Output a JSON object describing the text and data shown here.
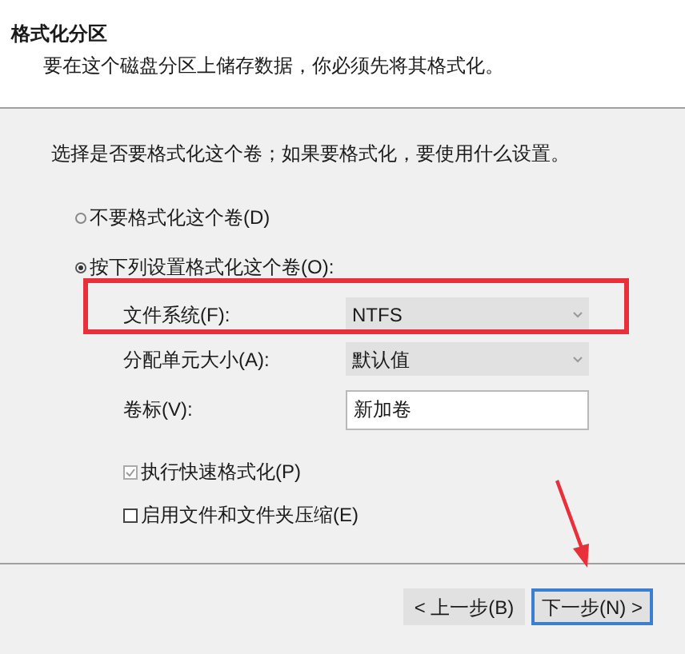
{
  "header": {
    "title": "格式化分区",
    "subtitle": "要在这个磁盘分区上储存数据，你必须先将其格式化。"
  },
  "instruction": "选择是否要格式化这个卷；如果要格式化，要使用什么设置。",
  "options": [
    {
      "label": "不要格式化这个卷(D)",
      "selected": false
    },
    {
      "label": "按下列设置格式化这个卷(O):",
      "selected": true
    }
  ],
  "settings": [
    {
      "kind": "dropdown",
      "label": "文件系统(F):",
      "value": "NTFS"
    },
    {
      "kind": "dropdown",
      "label": "分配单元大小(A):",
      "value": "默认值"
    },
    {
      "kind": "text",
      "label": "卷标(V):",
      "value": "新加卷"
    }
  ],
  "checkboxes": [
    {
      "label": "执行快速格式化(P)",
      "checked": true
    },
    {
      "label": "启用文件和文件夹压缩(E)",
      "checked": false
    }
  ],
  "buttons": [
    {
      "label": "< 上一步(B)",
      "focused": false
    },
    {
      "label": "下一步(N) >",
      "focused": true
    }
  ]
}
